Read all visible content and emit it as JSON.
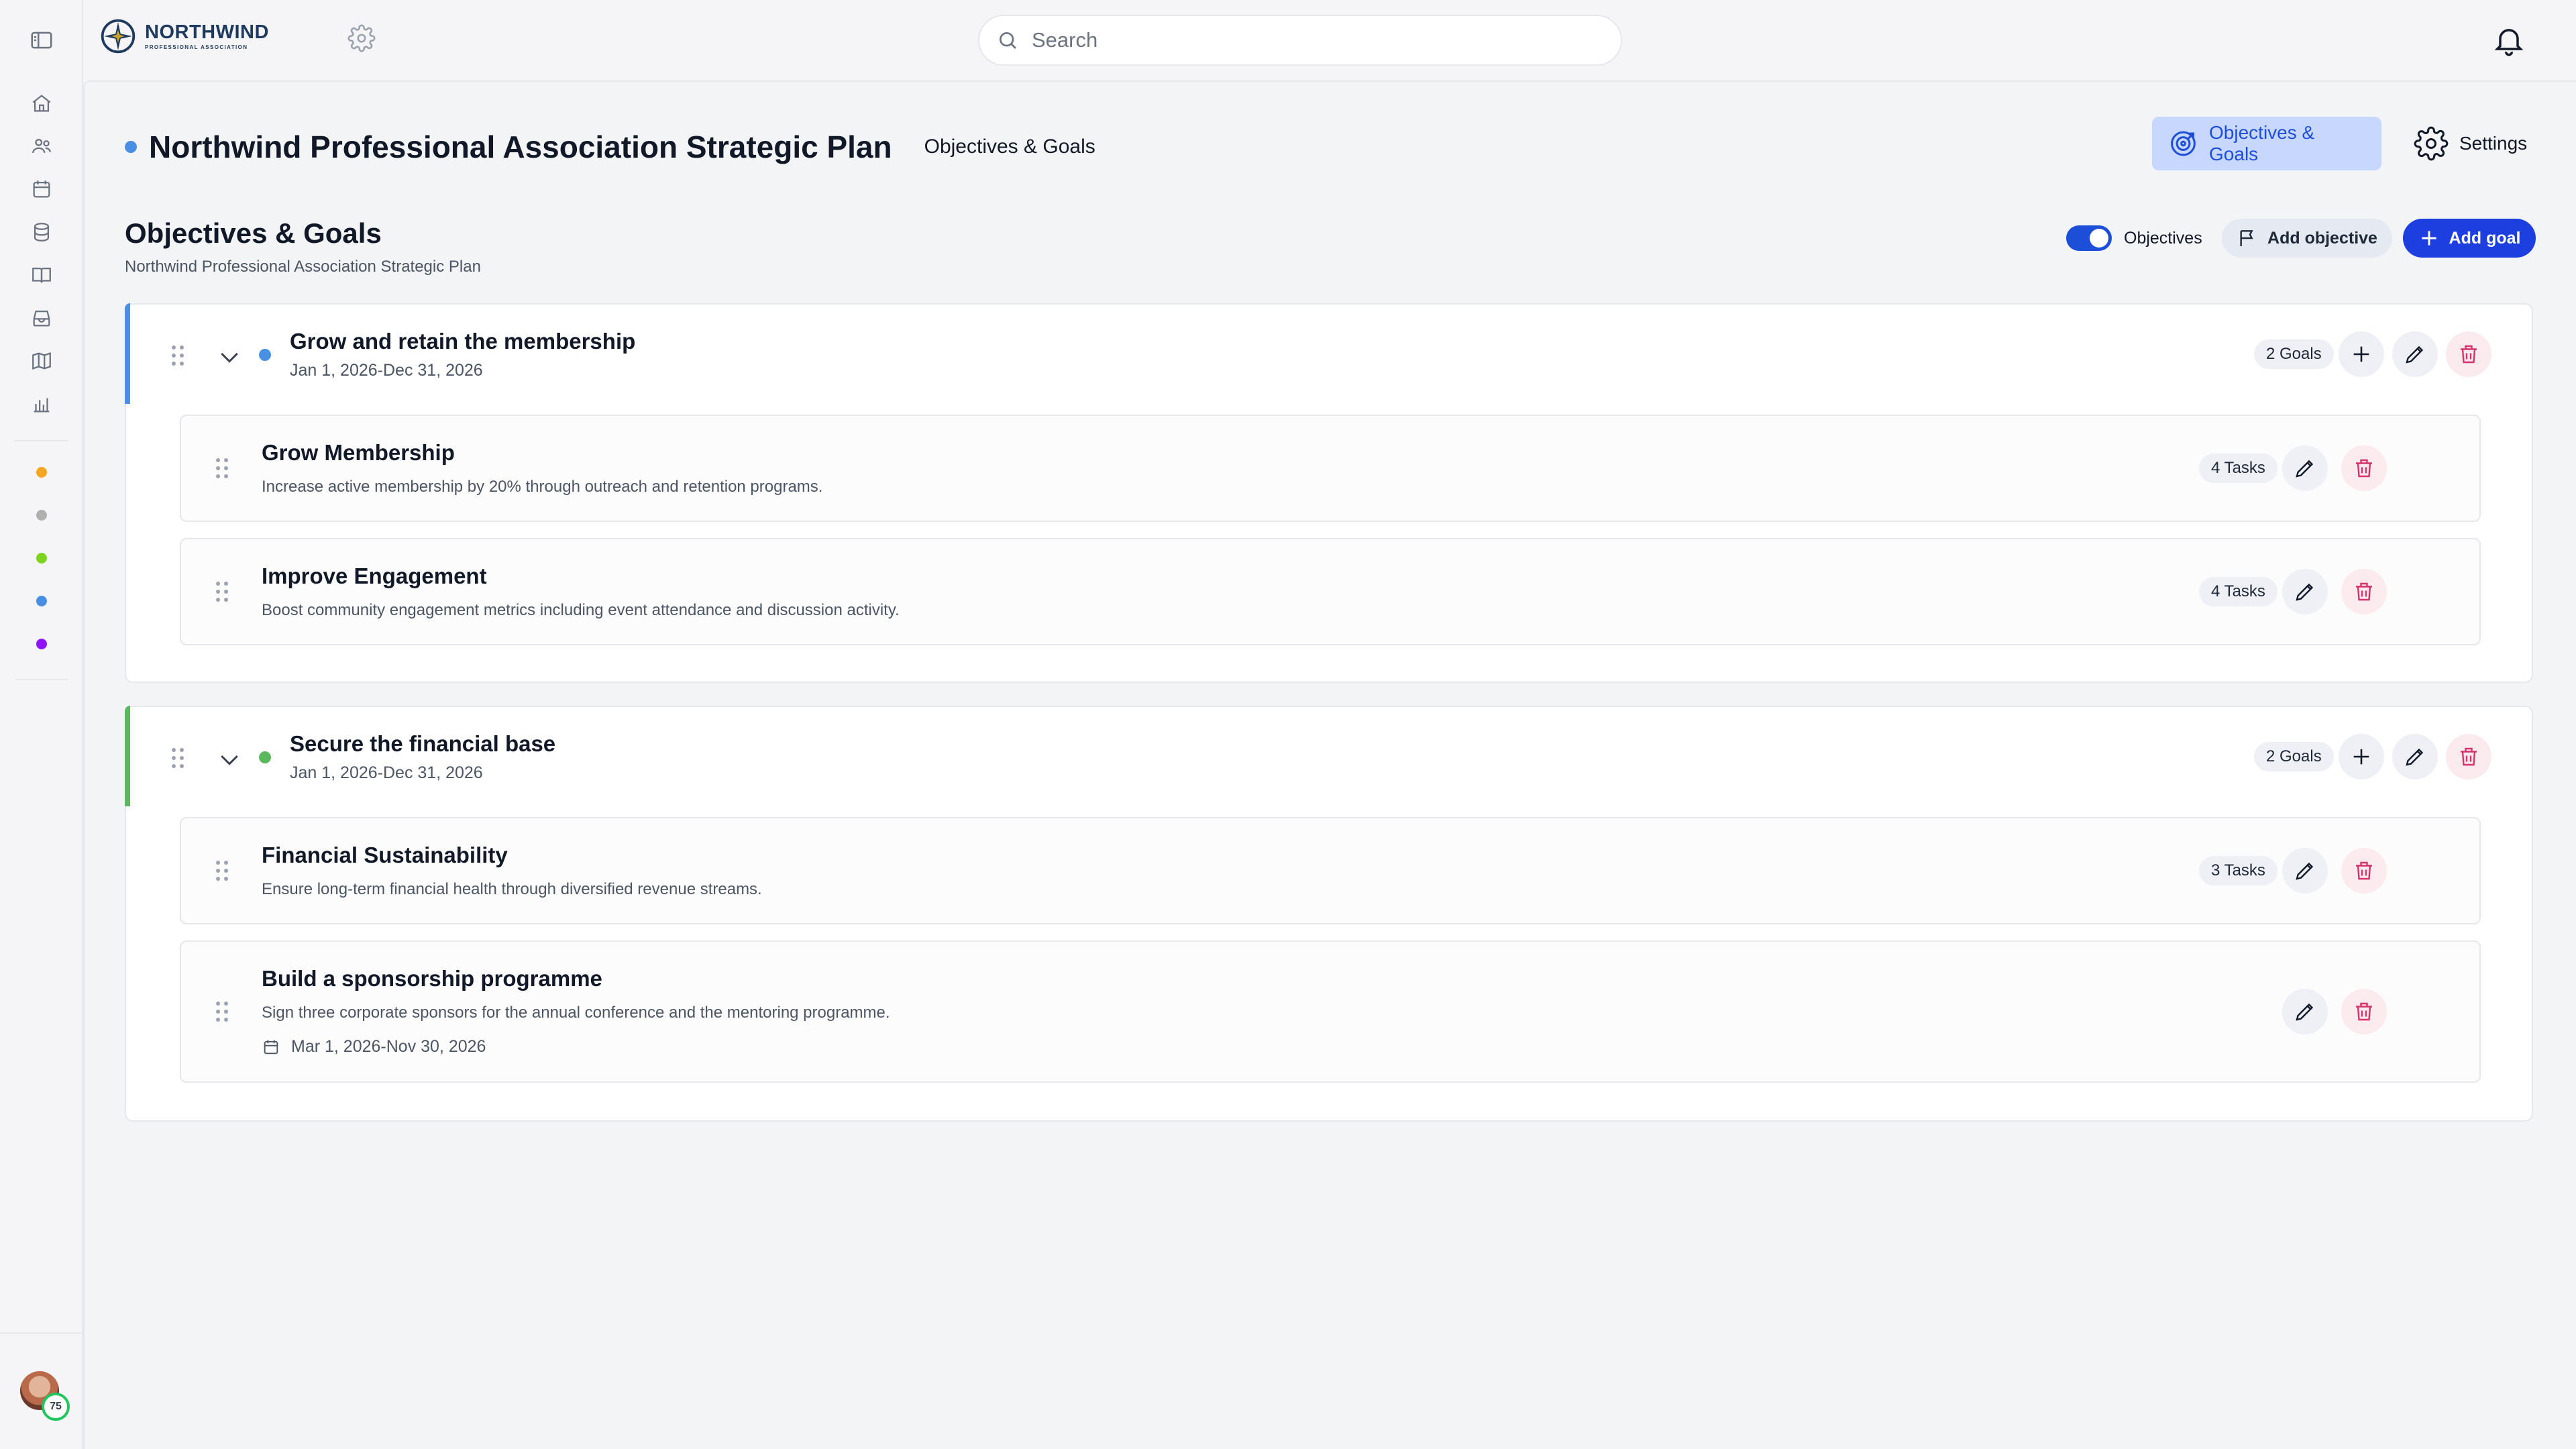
{
  "app": {
    "logo_name": "NORTHWIND",
    "logo_sub": "PROFESSIONAL ASSOCIATION"
  },
  "search": {
    "placeholder": "Search"
  },
  "rail": {
    "dots": [
      "#f5a623",
      "#b0b0b0",
      "#7ed321",
      "#4a90e2",
      "#9013fe"
    ],
    "avatar_badge": "75"
  },
  "header": {
    "plan_title": "Northwind Professional Association Strategic Plan",
    "crumb": "Objectives & Goals",
    "tabs": [
      {
        "label": "Objectives & Goals",
        "active": true
      },
      {
        "label": "Settings",
        "active": false
      }
    ]
  },
  "section": {
    "title": "Objectives & Goals",
    "subtitle": "Northwind Professional Association Strategic Plan",
    "toggle_label": "Objectives",
    "add_objective": "Add objective",
    "add_goal": "Add goal"
  },
  "objectives": [
    {
      "title": "Grow and retain the membership",
      "date": "Jan 1, 2026-Dec 31, 2026",
      "goals_count": "2 Goals",
      "color": "#4a90e2",
      "goals": [
        {
          "title": "Grow Membership",
          "description": "Increase active membership by 20% through outreach and retention programs.",
          "tasks": "4 Tasks"
        },
        {
          "title": "Improve Engagement",
          "description": "Boost community engagement metrics including event attendance and discussion activity.",
          "tasks": "4 Tasks"
        }
      ]
    },
    {
      "title": "Secure the financial base",
      "date": "Jan 1, 2026-Dec 31, 2026",
      "goals_count": "2 Goals",
      "color": "#5cb85c",
      "goals": [
        {
          "title": "Financial Sustainability",
          "description": "Ensure long-term financial health through diversified revenue streams.",
          "tasks": "3 Tasks"
        },
        {
          "title": "Build a sponsorship programme",
          "description": "Sign three corporate sponsors for the annual conference and the mentoring programme.",
          "date": "Mar 1, 2026-Nov 30, 2026"
        }
      ]
    }
  ]
}
